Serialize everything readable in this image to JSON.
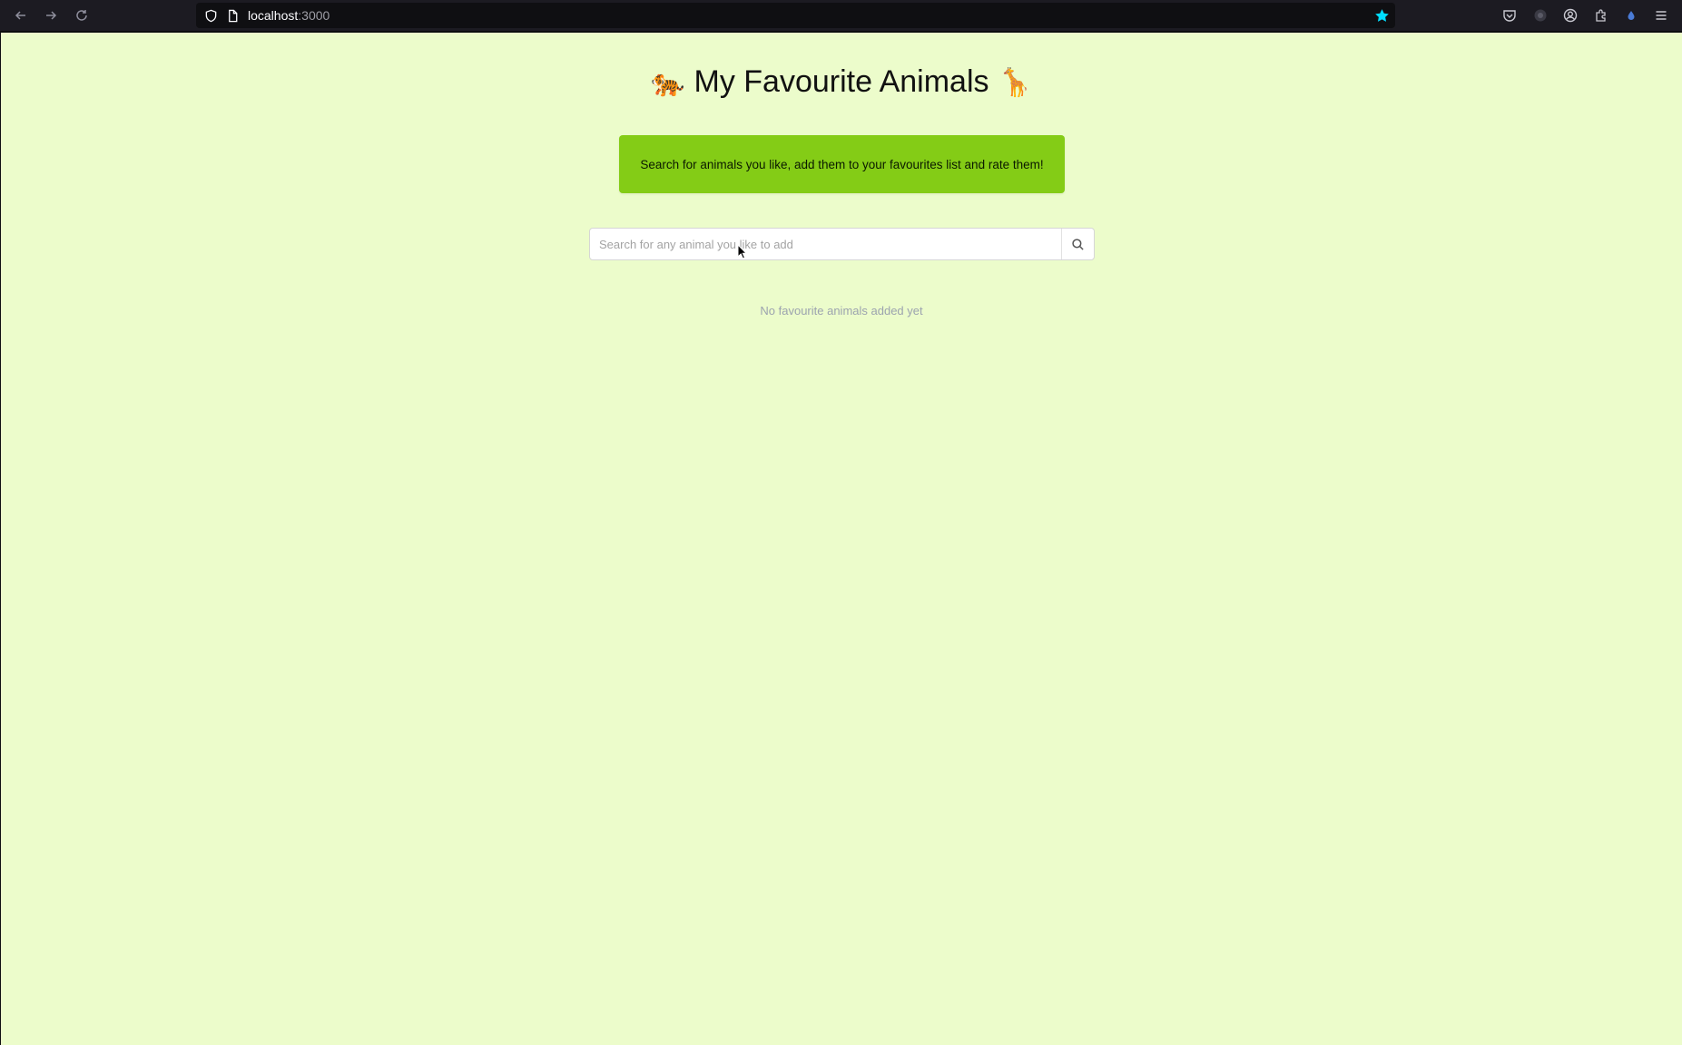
{
  "browser": {
    "url_host": "localhost",
    "url_port": ":3000"
  },
  "page": {
    "title_text": "My Favourite Animals",
    "title_emoji_left": "🐅",
    "title_emoji_right": "🦒",
    "banner_text": "Search for animals you like, add them to your favourites list and rate them!",
    "search": {
      "placeholder": "Search for any animal you like to add",
      "value": ""
    },
    "empty_message": "No favourite animals added yet"
  },
  "colors": {
    "page_background": "#ecfccb",
    "banner_background": "#84cc16",
    "bookmark_star": "#00ddff"
  },
  "icons": {
    "nav": [
      "back-arrow-icon",
      "forward-arrow-icon",
      "reload-icon"
    ],
    "urlbar": [
      "tracking-shield-icon",
      "page-icon",
      "bookmark-star-icon"
    ],
    "toolbar_right": [
      "pocket-icon",
      "extension-icon",
      "account-icon",
      "extensions-puzzle-icon",
      "extension-drop-icon",
      "menu-hamburger-icon"
    ],
    "search": "magnifier-icon"
  }
}
